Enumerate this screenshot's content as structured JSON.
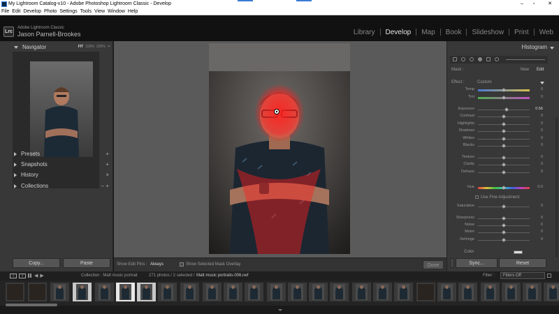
{
  "window": {
    "title": "My Lightroom Catalog-v10 - Adobe Photoshop Lightroom Classic - Develop",
    "minimize": "–",
    "maximize": "▫",
    "close": "✕"
  },
  "menu": [
    "File",
    "Edit",
    "Develop",
    "Photo",
    "Settings",
    "Tools",
    "View",
    "Window",
    "Help"
  ],
  "identity": {
    "logo": "Lrc",
    "product": "Adobe Lightroom Classic",
    "user": "Jason Parnell-Brookes"
  },
  "modules": [
    {
      "label": "Library",
      "active": false
    },
    {
      "label": "Develop",
      "active": true
    },
    {
      "label": "Map",
      "active": false
    },
    {
      "label": "Book",
      "active": false
    },
    {
      "label": "Slideshow",
      "active": false
    },
    {
      "label": "Print",
      "active": false
    },
    {
      "label": "Web",
      "active": false
    }
  ],
  "left": {
    "navigator": "Navigator",
    "zoom": {
      "fit": "FIT",
      "z100": "100%",
      "z200": "200%",
      "more": "≑"
    },
    "sections": [
      {
        "label": "Presets",
        "action": "+"
      },
      {
        "label": "Snapshots",
        "action": "+"
      },
      {
        "label": "History",
        "action": "×"
      },
      {
        "label": "Collections",
        "action": "− +"
      }
    ],
    "copy": "Copy...",
    "paste": "Paste"
  },
  "toolbar": {
    "show_pins_label": "Show Edit Pins :",
    "show_pins_value": "Always",
    "overlay_label": "Show Selected Mask Overlay",
    "done": "Done"
  },
  "right": {
    "histogram": "Histogram",
    "mask_label": "Mask :",
    "mask_new": "New",
    "mask_edit": "Edit",
    "effect_label": "Effect :",
    "effect_value": "Custom",
    "fine_adjust": "Use Fine Adjustment",
    "color_label": "Color",
    "sync": "Sync...",
    "reset": "Reset",
    "sliders": [
      {
        "label": "Temp",
        "value": "0",
        "level": 0.5,
        "grad": "temp"
      },
      {
        "label": "Tint",
        "value": "0",
        "level": 0.5,
        "grad": "tint"
      },
      {
        "label": "Exposure",
        "value": "0.56",
        "level": 0.56,
        "active": true
      },
      {
        "label": "Contrast",
        "value": "0",
        "level": 0.5
      },
      {
        "label": "Highlights",
        "value": "0",
        "level": 0.5
      },
      {
        "label": "Shadows",
        "value": "0",
        "level": 0.5
      },
      {
        "label": "Whites",
        "value": "0",
        "level": 0.5
      },
      {
        "label": "Blacks",
        "value": "0",
        "level": 0.5
      },
      {
        "label": "Texture",
        "value": "0",
        "level": 0.5
      },
      {
        "label": "Clarity",
        "value": "0",
        "level": 0.5
      },
      {
        "label": "Dehaze",
        "value": "0",
        "level": 0.5
      },
      {
        "label": "Hue",
        "value": "0.0",
        "level": 0.5,
        "grad": "hue"
      },
      {
        "label": "Saturation",
        "value": "0",
        "level": 0.5
      },
      {
        "label": "Sharpness",
        "value": "0",
        "level": 0.5
      },
      {
        "label": "Noise",
        "value": "0",
        "level": 0.5
      },
      {
        "label": "Moiré",
        "value": "0",
        "level": 0.5
      },
      {
        "label": "Defringe",
        "value": "0",
        "level": 0.5
      }
    ]
  },
  "filmstrip": {
    "monitor1": "1",
    "monitor2": "2",
    "collection": "Collection : Matt music portrait",
    "count": "271 photos / 2 selected /",
    "filename": "Matt music portraits-006.nef",
    "filter_label": "Filter :",
    "filter_value": "Filters Off"
  },
  "colors": {
    "mask_overlay": "#ff1e1e",
    "accent": "#3a7bd5"
  }
}
